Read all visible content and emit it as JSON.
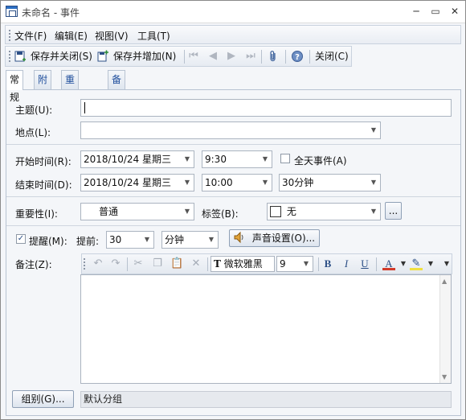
{
  "window": {
    "title": "未命名 - 事件"
  },
  "menu": [
    "文件(F)",
    "编辑(E)",
    "视图(V)",
    "工具(T)"
  ],
  "toolbar": {
    "save_close": "保存并关闭(S)",
    "save_add": "保存并增加(N)",
    "close": "关闭(C)"
  },
  "tabs": [
    "常规",
    "附件",
    "重复周期",
    "备注"
  ],
  "form": {
    "subject_label": "主题(U):",
    "subject_value": "",
    "location_label": "地点(L):",
    "location_value": "",
    "start_label": "开始时间(R):",
    "start_date": "2018/10/24 星期三",
    "start_time": "9:30",
    "allday_label": "全天事件(A)",
    "end_label": "结束时间(D):",
    "end_date": "2018/10/24 星期三",
    "end_time": "10:00",
    "duration": "30分钟",
    "importance_label": "重要性(I):",
    "importance_value": "普通",
    "tag_label": "标签(B):",
    "tag_value": "无",
    "tag_more": "...",
    "reminder_label": "提醒(M):",
    "advance_label": "提前:",
    "advance_value": "30",
    "advance_unit": "分钟",
    "sound_button": "声音设置(O)...",
    "notes_label": "备注(Z):",
    "font_name": "微软雅黑",
    "font_size": "9",
    "group_button": "组别(G)...",
    "group_value": "默认分组"
  }
}
